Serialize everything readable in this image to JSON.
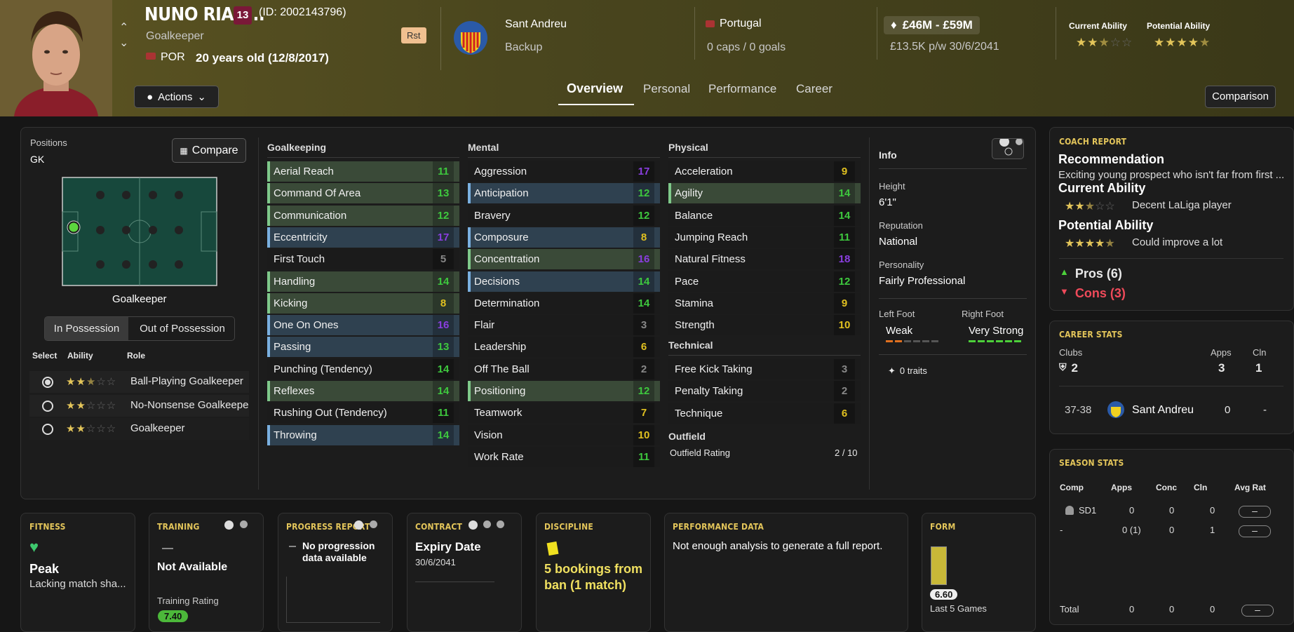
{
  "header": {
    "name": "NUNO RIAN...",
    "number": "13",
    "id": "(ID: 2002143796)",
    "position": "Goalkeeper",
    "nation": "POR",
    "age": "20 years old (12/8/2017)",
    "role_badge": "Rst",
    "actions": "Actions",
    "club": "Sant Andreu",
    "squad_status": "Backup",
    "country": "Portugal",
    "caps": "0 caps / 0 goals",
    "value": "£46M - £59M",
    "wage": "£13.5K p/w 30/6/2041",
    "ca_label": "Current Ability",
    "pa_label": "Potential Ability",
    "ca_stars": 2.5,
    "pa_stars": 4.5,
    "comparison": "Comparison",
    "tabs": [
      "Overview",
      "Personal",
      "Performance",
      "Career"
    ]
  },
  "positions": {
    "label": "Positions",
    "value": "GK",
    "compare": "Compare",
    "pitch_label": "Goalkeeper",
    "in_poss": "In Possession",
    "out_poss": "Out of Possession",
    "col_select": "Select",
    "col_ability": "Ability",
    "col_role": "Role",
    "roles": [
      {
        "name": "Ball-Playing Goalkeeper",
        "stars": 2.5
      },
      {
        "name": "No-Nonsense Goalkeepe",
        "stars": 2
      },
      {
        "name": "Goalkeeper",
        "stars": 2
      }
    ]
  },
  "gk": {
    "title": "Goalkeeping",
    "rows": [
      {
        "n": "Aerial Reach",
        "v": "11",
        "c": "#3ec83e",
        "h": "g"
      },
      {
        "n": "Command Of Area",
        "v": "13",
        "c": "#3ec83e",
        "h": "g"
      },
      {
        "n": "Communication",
        "v": "12",
        "c": "#3ec83e",
        "h": "g"
      },
      {
        "n": "Eccentricity",
        "v": "17",
        "c": "#8a3ee0",
        "h": "b"
      },
      {
        "n": "First Touch",
        "v": "5",
        "c": "#888",
        "h": ""
      },
      {
        "n": "Handling",
        "v": "14",
        "c": "#3ec83e",
        "h": "g"
      },
      {
        "n": "Kicking",
        "v": "8",
        "c": "#e0c020",
        "h": "g"
      },
      {
        "n": "One On Ones",
        "v": "16",
        "c": "#8a3ee0",
        "h": "b"
      },
      {
        "n": "Passing",
        "v": "13",
        "c": "#3ec83e",
        "h": "b"
      },
      {
        "n": "Punching (Tendency)",
        "v": "14",
        "c": "#3ec83e",
        "h": ""
      },
      {
        "n": "Reflexes",
        "v": "14",
        "c": "#3ec83e",
        "h": "g"
      },
      {
        "n": "Rushing Out (Tendency)",
        "v": "11",
        "c": "#3ec83e",
        "h": ""
      },
      {
        "n": "Throwing",
        "v": "14",
        "c": "#3ec83e",
        "h": "b"
      }
    ]
  },
  "mental": {
    "title": "Mental",
    "rows": [
      {
        "n": "Aggression",
        "v": "17",
        "c": "#8a3ee0",
        "h": ""
      },
      {
        "n": "Anticipation",
        "v": "12",
        "c": "#3ec83e",
        "h": "b"
      },
      {
        "n": "Bravery",
        "v": "12",
        "c": "#3ec83e",
        "h": ""
      },
      {
        "n": "Composure",
        "v": "8",
        "c": "#e0c020",
        "h": "b"
      },
      {
        "n": "Concentration",
        "v": "16",
        "c": "#8a3ee0",
        "h": "g"
      },
      {
        "n": "Decisions",
        "v": "14",
        "c": "#3ec83e",
        "h": "b"
      },
      {
        "n": "Determination",
        "v": "14",
        "c": "#3ec83e",
        "h": ""
      },
      {
        "n": "Flair",
        "v": "3",
        "c": "#888",
        "h": ""
      },
      {
        "n": "Leadership",
        "v": "6",
        "c": "#e0c020",
        "h": ""
      },
      {
        "n": "Off The Ball",
        "v": "2",
        "c": "#888",
        "h": ""
      },
      {
        "n": "Positioning",
        "v": "12",
        "c": "#3ec83e",
        "h": "g"
      },
      {
        "n": "Teamwork",
        "v": "7",
        "c": "#e0c020",
        "h": ""
      },
      {
        "n": "Vision",
        "v": "10",
        "c": "#e0c020",
        "h": ""
      },
      {
        "n": "Work Rate",
        "v": "11",
        "c": "#3ec83e",
        "h": ""
      }
    ]
  },
  "physical": {
    "title": "Physical",
    "rows": [
      {
        "n": "Acceleration",
        "v": "9",
        "c": "#e0c020",
        "h": ""
      },
      {
        "n": "Agility",
        "v": "14",
        "c": "#3ec83e",
        "h": "g"
      },
      {
        "n": "Balance",
        "v": "14",
        "c": "#3ec83e",
        "h": ""
      },
      {
        "n": "Jumping Reach",
        "v": "11",
        "c": "#3ec83e",
        "h": ""
      },
      {
        "n": "Natural Fitness",
        "v": "18",
        "c": "#8a3ee0",
        "h": ""
      },
      {
        "n": "Pace",
        "v": "12",
        "c": "#3ec83e",
        "h": ""
      },
      {
        "n": "Stamina",
        "v": "9",
        "c": "#e0c020",
        "h": ""
      },
      {
        "n": "Strength",
        "v": "10",
        "c": "#e0c020",
        "h": ""
      }
    ]
  },
  "technical": {
    "title": "Technical",
    "rows": [
      {
        "n": "Free Kick Taking",
        "v": "3",
        "c": "#888",
        "h": ""
      },
      {
        "n": "Penalty Taking",
        "v": "2",
        "c": "#888",
        "h": ""
      },
      {
        "n": "Technique",
        "v": "6",
        "c": "#e0c020",
        "h": ""
      }
    ]
  },
  "outfield": {
    "title": "Outfield",
    "label": "Outfield Rating",
    "value": "2 / 10"
  },
  "info": {
    "title": "Info",
    "height_l": "Height",
    "height": "6'1\"",
    "rep_l": "Reputation",
    "rep": "National",
    "pers_l": "Personality",
    "pers": "Fairly Professional",
    "lf_l": "Left Foot",
    "lf": "Weak",
    "rf_l": "Right Foot",
    "rf": "Very Strong",
    "traits": "0 traits"
  },
  "coach": {
    "title": "COACH REPORT",
    "rec_h": "Recommendation",
    "rec": "Exciting young prospect who isn't far from first ...",
    "ca_h": "Current Ability",
    "ca": "Decent LaLiga player",
    "pa_h": "Potential Ability",
    "pa": "Could improve a lot",
    "pros": "Pros (6)",
    "cons": "Cons (3)"
  },
  "career": {
    "title": "CAREER STATS",
    "clubs_l": "Clubs",
    "clubs": "2",
    "apps_l": "Apps",
    "apps": "3",
    "cln_l": "Cln",
    "cln": "1",
    "season": "37-38",
    "club": "Sant Andreu",
    "s_apps": "0",
    "s_cln": "-"
  },
  "season": {
    "title": "SEASON STATS",
    "cols": [
      "Comp",
      "Apps",
      "Conc",
      "Cln",
      "Avg Rat"
    ],
    "rows": [
      {
        "comp": "SD1",
        "apps": "0",
        "conc": "0",
        "cln": "0",
        "rat": "–"
      },
      {
        "comp": "-",
        "apps": "0 (1)",
        "conc": "0",
        "cln": "1",
        "rat": "–"
      }
    ],
    "total": {
      "comp": "Total",
      "apps": "0",
      "conc": "0",
      "cln": "0",
      "rat": "–"
    }
  },
  "bottom": {
    "fitness": {
      "title": "FITNESS",
      "v": "Peak",
      "sub": "Lacking match sha..."
    },
    "training": {
      "title": "TRAINING",
      "v": "Not Available",
      "rl": "Training Rating",
      "r": "7.40"
    },
    "progress": {
      "title": "PROGRESS REPORT",
      "v": "No progression data available"
    },
    "contract": {
      "title": "CONTRACT",
      "v": "Expiry Date",
      "d": "30/6/2041"
    },
    "discipline": {
      "title": "DISCIPLINE",
      "v": "5 bookings from ban (1 match)"
    },
    "perf": {
      "title": "PERFORMANCE DATA",
      "v": "Not enough analysis to generate a full report."
    },
    "form": {
      "title": "FORM",
      "v": "6.60",
      "sub": "Last 5 Games"
    }
  },
  "colors": {
    "accent": "#e3c55a",
    "green": "#3ec83e",
    "purple": "#8a3ee0",
    "yellow": "#e0c020",
    "red": "#e04050"
  }
}
